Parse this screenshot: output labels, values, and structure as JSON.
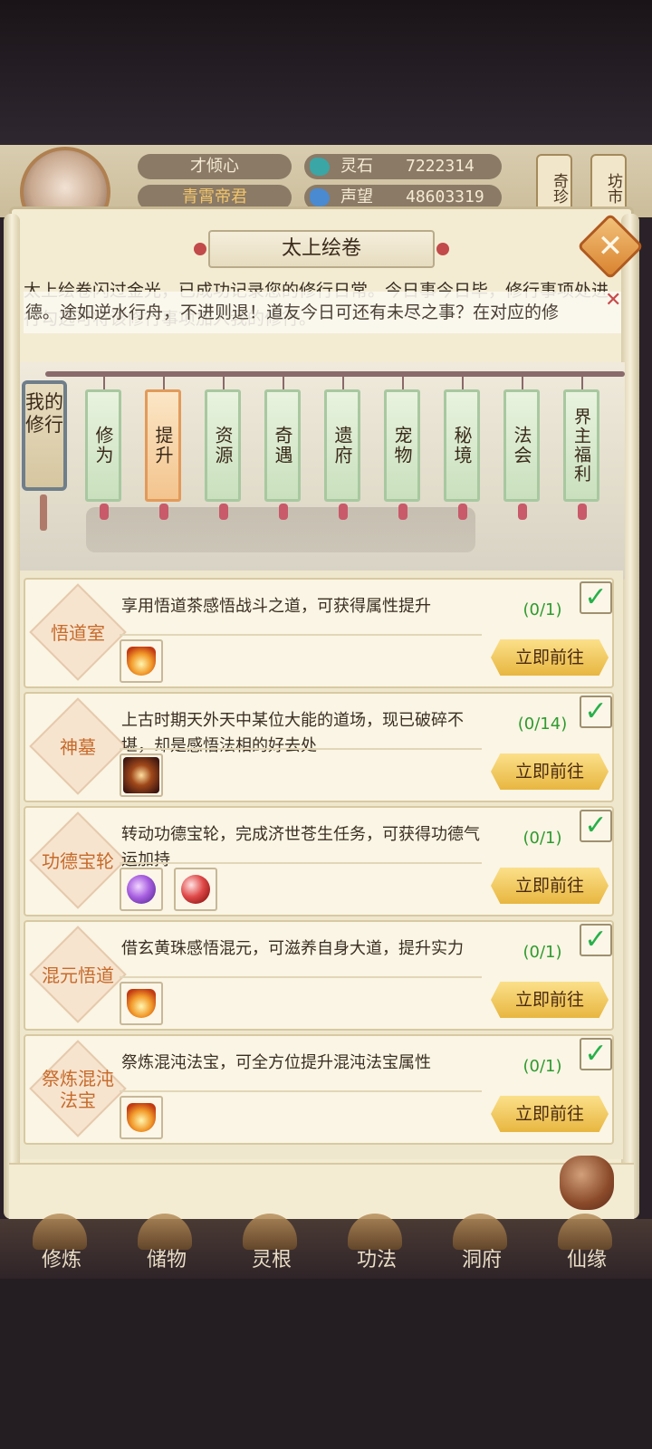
{
  "header": {
    "player_name": "才倾心",
    "player_title": "青霄帝君",
    "stats": [
      {
        "label": "灵石",
        "value": "7222314"
      },
      {
        "label": "声望",
        "value": "48603319"
      }
    ],
    "side_buttons": [
      "奇珍",
      "坊市"
    ]
  },
  "dialog": {
    "title": "太上绘卷",
    "intro": "太上绘卷闪过金光，已成功记录您的修行日常。今日事今日毕，修行事项处进行勾选可将该修行事项加入我的修行。",
    "toast": "德。途如逆水行舟，不进则退！道友今日可还有未尽之事？在对应的修"
  },
  "tabs": {
    "my": "我的修行",
    "items": [
      "修为",
      "提升",
      "资源",
      "奇遇",
      "遗府",
      "宠物",
      "秘境",
      "法会",
      "界主福利"
    ],
    "active_index": 1
  },
  "tasks": [
    {
      "name": "悟道室",
      "desc": "享用悟道茶感悟战斗之道，可获得属性提升",
      "progress": "(0/1)",
      "checked": true,
      "button": "立即前往",
      "icons": [
        "fire"
      ]
    },
    {
      "name": "神墓",
      "desc": "上古时期天外天中某位大能的道场，现已破碎不堪，却是感悟法相的好去处",
      "progress": "(0/14)",
      "checked": true,
      "button": "立即前往",
      "icons": [
        "mark"
      ]
    },
    {
      "name": "功德宝轮",
      "desc": "转动功德宝轮，完成济世苍生任务，可获得功德气运加持",
      "progress": "(0/1)",
      "checked": true,
      "button": "立即前往",
      "icons": [
        "purple",
        "red"
      ]
    },
    {
      "name": "混元悟道",
      "desc": "借玄黄珠感悟混元，可滋养自身大道，提升实力",
      "progress": "(0/1)",
      "checked": true,
      "button": "立即前往",
      "icons": [
        "fire"
      ]
    },
    {
      "name": "祭炼混沌法宝",
      "desc": "祭炼混沌法宝，可全方位提升混沌法宝属性",
      "progress": "(0/1)",
      "checked": true,
      "button": "立即前往",
      "icons": [
        "fire"
      ]
    }
  ],
  "bottom_nav": [
    "修炼",
    "储物",
    "灵根",
    "功法",
    "洞府",
    "仙缘"
  ],
  "colors": {
    "accent": "#e8b640",
    "check": "#27b04a",
    "badge_text": "#c76a2a"
  }
}
